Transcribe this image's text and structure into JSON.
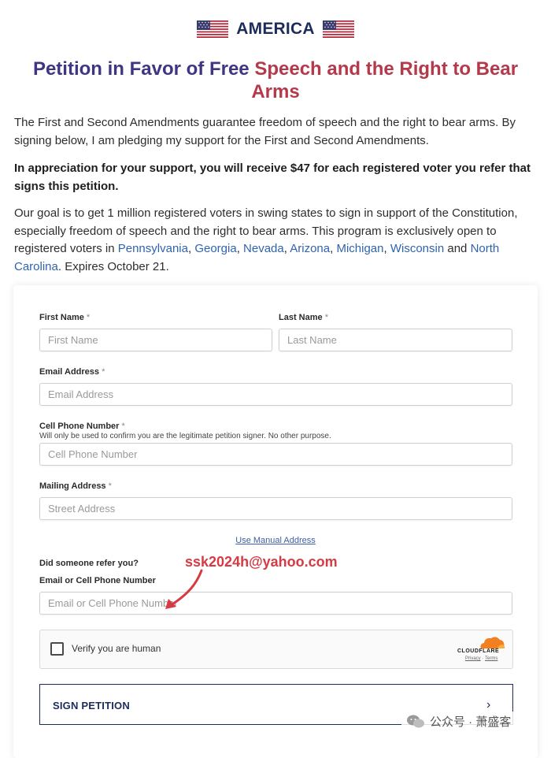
{
  "header": {
    "brand": "AMERICA",
    "flag_icon": "us-flag-icon"
  },
  "title": {
    "part1": "Petition in Favor of Free ",
    "part2": "Speech and the Right to Bear Arms"
  },
  "intro": {
    "p1": "The First and Second Amendments guarantee freedom of speech and the right to bear arms. By signing below, I am pledging my support for the First and Second Amendments.",
    "p2": "In appreciation for your support, you will receive $47 for each registered voter you refer that signs this petition.",
    "p3_start": "Our goal is to get 1 million registered voters in swing states to sign in support of the Constitution, especially freedom of speech and the right to bear arms. This program is exclusively open to registered voters in ",
    "states": [
      "Pennsylvania",
      "Georgia",
      "Nevada",
      "Arizona",
      "Michigan",
      "Wisconsin",
      "North Carolina"
    ],
    "sep_comma": ", ",
    "sep_and": " and ",
    "p3_end": ". Expires October 21."
  },
  "form": {
    "first_name": {
      "label": "First Name",
      "placeholder": "First Name"
    },
    "last_name": {
      "label": "Last Name",
      "placeholder": "Last Name"
    },
    "email": {
      "label": "Email Address",
      "placeholder": "Email Address"
    },
    "phone": {
      "label": "Cell Phone Number",
      "hint": "Will only be used to confirm you are the legitimate petition signer. No other purpose.",
      "placeholder": "Cell Phone Number"
    },
    "mailing": {
      "label": "Mailing Address",
      "placeholder": "Street Address"
    },
    "required_mark": "*",
    "manual_address_link": "Use Manual Address",
    "referral_question": "Did someone refer you?",
    "referral": {
      "label": "Email or Cell Phone Number",
      "placeholder": "Email or Cell Phone Number"
    },
    "captcha": {
      "label": "Verify you are human",
      "brand": "CLOUDFLARE",
      "privacy": "Privacy",
      "sep": " · ",
      "terms": "Terms"
    },
    "submit_label": "SIGN PETITION"
  },
  "overlay_annotation": {
    "text": "ssk2024h@yahoo.com",
    "color": "#d63a43"
  },
  "watermark": {
    "text": "公众号 · 萧盛客"
  },
  "colors": {
    "brand_navy": "#1c2c5b",
    "title_blue": "#3e3585",
    "title_red": "#b4394a",
    "link_blue": "#2f64ad",
    "cloudflare_orange": "#f38020"
  }
}
